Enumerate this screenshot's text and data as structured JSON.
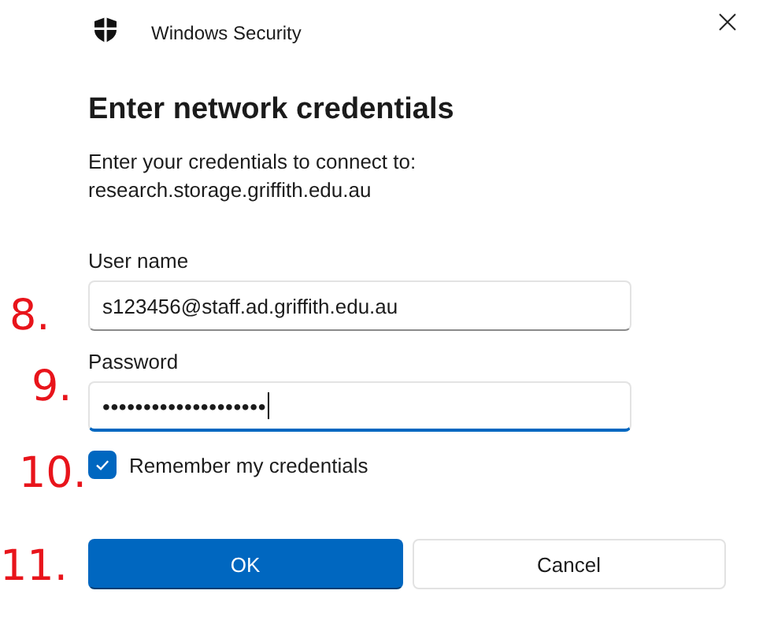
{
  "window": {
    "title": "Windows Security"
  },
  "heading": "Enter network credentials",
  "description": [
    "Enter your credentials to connect to:",
    "research.storage.griffith.edu.au"
  ],
  "fields": [
    {
      "label": "User name",
      "value": "s123456@staff.ad.griffith.edu.au",
      "focused": false
    },
    {
      "label": "Password",
      "value": "••••••••••••••••••••",
      "focused": true
    }
  ],
  "remember": {
    "label": "Remember my credentials",
    "checked": true
  },
  "buttons": [
    {
      "label": "OK",
      "kind": "primary"
    },
    {
      "label": "Cancel",
      "kind": "secondary"
    }
  ],
  "annotations": [
    "8.",
    "9.",
    "10.",
    "11."
  ]
}
